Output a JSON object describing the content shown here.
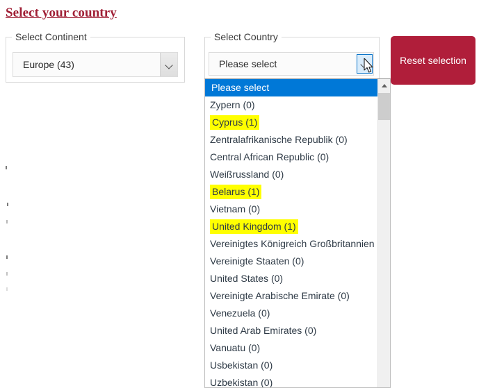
{
  "page": {
    "title": "Select your country"
  },
  "continent_group": {
    "legend": "Select Continent",
    "select": {
      "value": "Europe (43)",
      "arrow_icon": "chevron-down-icon"
    }
  },
  "country_group": {
    "legend": "Select Country",
    "select": {
      "value": "Please select",
      "placeholder": "Please select",
      "arrow_icon": "chevron-down-icon",
      "arrow_state": "hovered"
    },
    "listbox": {
      "scrollbar": {
        "up_arrow_icon": "caret-up-icon",
        "thumb_position_percent": 4
      },
      "options": [
        {
          "label": "Please select",
          "selected": true,
          "highlighted": false
        },
        {
          "label": "Zypern (0)",
          "selected": false,
          "highlighted": false
        },
        {
          "label": "Cyprus (1)",
          "selected": false,
          "highlighted": true
        },
        {
          "label": "Zentralafrikanische Republik (0)",
          "selected": false,
          "highlighted": false
        },
        {
          "label": "Central African Republic (0)",
          "selected": false,
          "highlighted": false
        },
        {
          "label": "Weißrussland (0)",
          "selected": false,
          "highlighted": false
        },
        {
          "label": "Belarus (1)",
          "selected": false,
          "highlighted": true
        },
        {
          "label": "Vietnam (0)",
          "selected": false,
          "highlighted": false
        },
        {
          "label": "United Kingdom (1)",
          "selected": false,
          "highlighted": true
        },
        {
          "label": "Vereinigtes Königreich Großbritannien (0)",
          "selected": false,
          "highlighted": false
        },
        {
          "label": "Vereinigte Staaten (0)",
          "selected": false,
          "highlighted": false
        },
        {
          "label": "United States (0)",
          "selected": false,
          "highlighted": false
        },
        {
          "label": "Vereinigte Arabische Emirate (0)",
          "selected": false,
          "highlighted": false
        },
        {
          "label": "Venezuela (0)",
          "selected": false,
          "highlighted": false
        },
        {
          "label": "United Arab Emirates (0)",
          "selected": false,
          "highlighted": false
        },
        {
          "label": "Vanuatu (0)",
          "selected": false,
          "highlighted": false
        },
        {
          "label": "Usbekistan (0)",
          "selected": false,
          "highlighted": false
        },
        {
          "label": "Uzbekistan (0)",
          "selected": false,
          "highlighted": false
        }
      ]
    }
  },
  "reset_button": {
    "label": "Reset selection"
  },
  "colors": {
    "title": "#a02036",
    "accent_button": "#b01e3a",
    "selection_blue": "#0078d7",
    "match_highlight": "#ffff00"
  }
}
